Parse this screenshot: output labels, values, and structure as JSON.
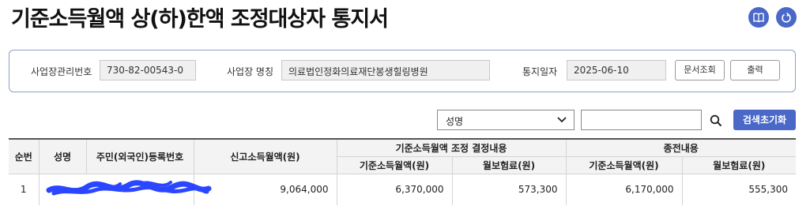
{
  "page": {
    "title": "기준소득월액 상(하)한액 조정대상자 통지서"
  },
  "icons": {
    "manual": "book-icon",
    "refresh": "refresh-icon"
  },
  "colors": {
    "accent": "#4a68c8",
    "border": "#8ea0c8"
  },
  "info": {
    "workplace_no_label": "사업장관리번호",
    "workplace_no_value": "730-82-00543-0",
    "workplace_name_label": "사업장 명칭",
    "workplace_name_value": "의료법인정화의료재단봉생힐링병원",
    "notice_date_label": "통지일자",
    "notice_date_value": "2025-06-10",
    "doc_lookup_button": "문서조회",
    "print_button": "출력"
  },
  "search": {
    "select_value": "성명",
    "input_value": "",
    "reset_button": "검색초기화"
  },
  "table": {
    "headers": {
      "seq": "순번",
      "name": "성명",
      "resident_no": "주민(외국인)등록번호",
      "reported_income": "신고소득월액(원)",
      "decision_group": "기준소득월액 조정 결정내용",
      "decision_income": "기준소득월액(원)",
      "decision_premium": "월보험료(원)",
      "previous_group": "종전내용",
      "previous_income": "기준소득월액(원)",
      "previous_premium": "월보험료(원)"
    },
    "rows": [
      {
        "seq": "1",
        "reported_income": "9,064,000",
        "decision_income": "6,370,000",
        "decision_premium": "573,300",
        "previous_income": "6,170,000",
        "previous_premium": "555,300"
      }
    ]
  }
}
